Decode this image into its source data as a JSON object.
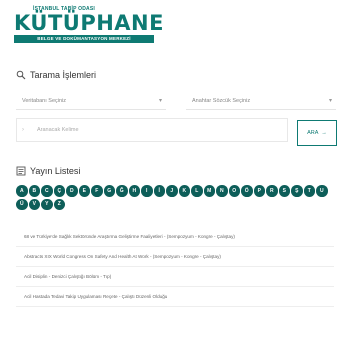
{
  "logo": {
    "top": "İSTANBUL TABİP ODASI",
    "main": "KÜTÜPHANE",
    "subtitle": "BELGE VE DOKÜMANTASYON MERKEZİ"
  },
  "search_section": {
    "title": "Tarama İşlemleri",
    "icon": "search-icon",
    "database_select": "Veritabanı Seçiniz",
    "field_select": "Anahtar Sözcük Seçiniz",
    "input_placeholder": "Aranacak Kelime",
    "search_button": "ARA"
  },
  "list_section": {
    "title": "Yayın Listesi",
    "icon": "list-icon",
    "letters": [
      "A",
      "B",
      "C",
      "Ç",
      "D",
      "E",
      "F",
      "G",
      "Ğ",
      "H",
      "I",
      "İ",
      "J",
      "K",
      "L",
      "M",
      "N",
      "O",
      "Ö",
      "P",
      "R",
      "S",
      "Ş",
      "T",
      "U",
      "Ü",
      "V",
      "Y",
      "Z"
    ]
  },
  "results": [
    "68 ve Türkiye'de Sağlık Sektöründe Araştırma Geliştirme Faaliyetleri - (Sempozyum - Kongre - Çalıştay)",
    "Abstracts XIX World Congress On Safety And Health At Work - (Sempozyum - Kongre - Çalıştay)",
    "Acil Disiplin - Denizci Çalıştığı Bölüm - Tıp)",
    "Acil Hastada Tedavi Takip Uygulaması Reçete - Çalıştı Düzenli Olduğu"
  ],
  "colors": {
    "brand": "#0e7a73",
    "letter_bg": "#0d5e59"
  }
}
